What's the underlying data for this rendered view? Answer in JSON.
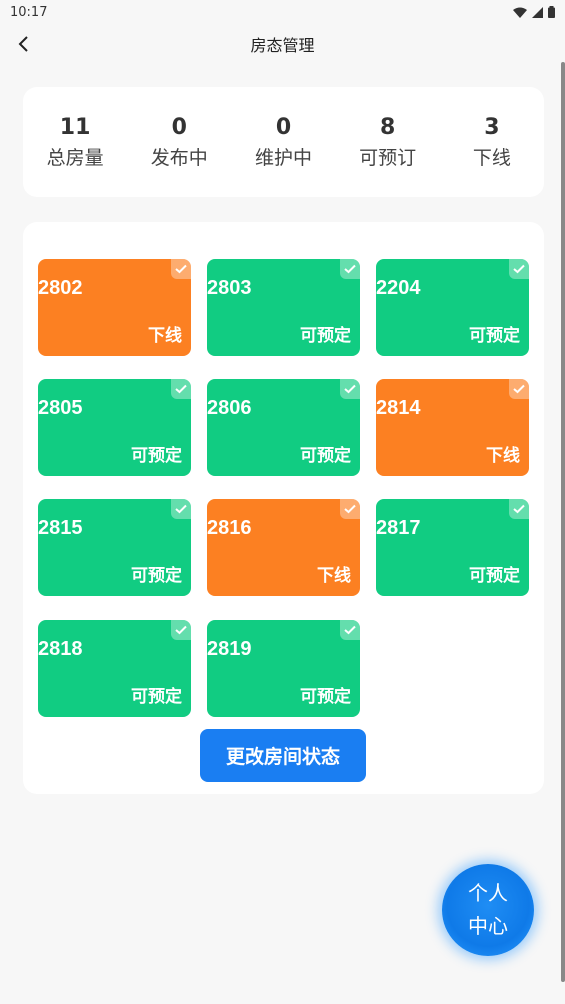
{
  "status_bar": {
    "time": "10:17"
  },
  "header": {
    "title": "房态管理"
  },
  "stats": [
    {
      "value": "11",
      "label": "总房量"
    },
    {
      "value": "0",
      "label": "发布中"
    },
    {
      "value": "0",
      "label": "维护中"
    },
    {
      "value": "8",
      "label": "可预订"
    },
    {
      "value": "3",
      "label": "下线"
    }
  ],
  "rooms": [
    {
      "number": "2802",
      "status": "下线",
      "color": "#fc8022"
    },
    {
      "number": "2803",
      "status": "可预定",
      "color": "#11cc82"
    },
    {
      "number": "2204",
      "status": "可预定",
      "color": "#11cc82"
    },
    {
      "number": "2805",
      "status": "可预定",
      "color": "#11cc82"
    },
    {
      "number": "2806",
      "status": "可预定",
      "color": "#11cc82"
    },
    {
      "number": "2814",
      "status": "下线",
      "color": "#fc8022"
    },
    {
      "number": "2815",
      "status": "可预定",
      "color": "#11cc82"
    },
    {
      "number": "2816",
      "status": "下线",
      "color": "#fc8022"
    },
    {
      "number": "2817",
      "status": "可预定",
      "color": "#11cc82"
    },
    {
      "number": "2818",
      "status": "可预定",
      "color": "#11cc82"
    },
    {
      "number": "2819",
      "status": "可预定",
      "color": "#11cc82"
    }
  ],
  "actions": {
    "change_status": "更改房间状态"
  },
  "fab": {
    "line1": "个人",
    "line2": "中心"
  }
}
